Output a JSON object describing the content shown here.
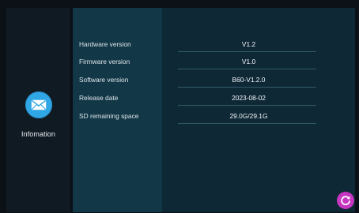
{
  "sidebar": {
    "items": [
      {
        "label": "Infomation",
        "icon": "envelope-icon",
        "accent": "#2fa6e6"
      }
    ]
  },
  "info_rows": [
    {
      "label": "Hardware version",
      "value": "V1.2"
    },
    {
      "label": "Firmware version",
      "value": "V1.0"
    },
    {
      "label": "Software version",
      "value": "B60-V1.2.0"
    },
    {
      "label": "Release date",
      "value": "2023-08-02"
    },
    {
      "label": "SD remaining space",
      "value": "29.0G/29.1G"
    }
  ],
  "actions": {
    "refresh": {
      "icon": "refresh-icon",
      "color": "#c736c1"
    }
  }
}
